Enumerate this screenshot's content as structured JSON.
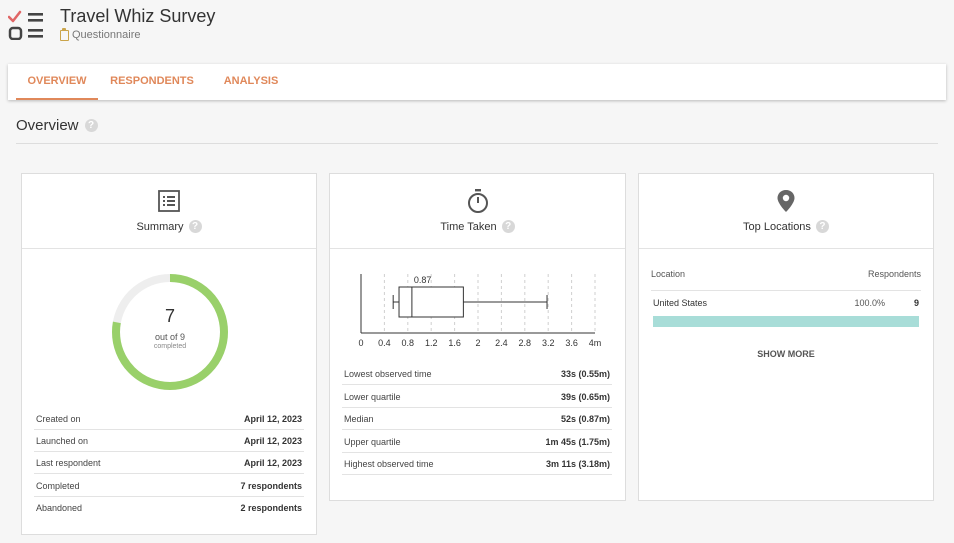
{
  "app": {
    "title": "Travel Whiz Survey",
    "subtitle": "Questionnaire",
    "accent": "#e0885a"
  },
  "tabs": [
    {
      "label": "OVERVIEW",
      "active": true
    },
    {
      "label": "RESPONDENTS",
      "active": false
    },
    {
      "label": "ANALYSIS",
      "active": false
    }
  ],
  "overview": {
    "title": "Overview",
    "help_icon": "question-icon"
  },
  "summary": {
    "title": "Summary",
    "icon": "list-icon",
    "completed": "7",
    "out_of": "out of 9",
    "completed_label": "completed",
    "progress_fraction": 0.7778,
    "ring_color": "#99d06a",
    "rows": [
      {
        "label": "Created on",
        "value": "April 12, 2023"
      },
      {
        "label": "Launched on",
        "value": "April 12, 2023"
      },
      {
        "label": "Last respondent",
        "value": "April 12, 2023"
      },
      {
        "label": "Completed",
        "value": "7 respondents"
      },
      {
        "label": "Abandoned",
        "value": "2 respondents"
      }
    ]
  },
  "time_taken": {
    "title": "Time Taken",
    "icon": "stopwatch-icon",
    "chart_data": {
      "type": "boxplot",
      "x_ticks": [
        "0",
        "0.4",
        "0.8",
        "1.2",
        "1.6",
        "2",
        "2.4",
        "2.8",
        "3.2",
        "3.6",
        "4m"
      ],
      "xlim": [
        0,
        4
      ],
      "min": 0.55,
      "q1": 0.65,
      "median": 0.87,
      "q3": 1.75,
      "max": 3.18,
      "median_label": "0.87"
    },
    "rows": [
      {
        "label": "Lowest observed time",
        "value": "33s (0.55m)"
      },
      {
        "label": "Lower quartile",
        "value": "39s (0.65m)"
      },
      {
        "label": "Median",
        "value": "52s (0.87m)"
      },
      {
        "label": "Upper quartile",
        "value": "1m 45s (1.75m)"
      },
      {
        "label": "Highest observed time",
        "value": "3m 11s (3.18m)"
      }
    ]
  },
  "locations": {
    "title": "Top Locations",
    "icon": "map-pin-icon",
    "col_location": "Location",
    "col_respondents": "Respondents",
    "rows": [
      {
        "name": "United States",
        "percent": "100.0%",
        "count": "9",
        "fraction": 1.0
      }
    ],
    "show_more": "SHOW MORE",
    "bar_color": "#a8ddd8"
  }
}
